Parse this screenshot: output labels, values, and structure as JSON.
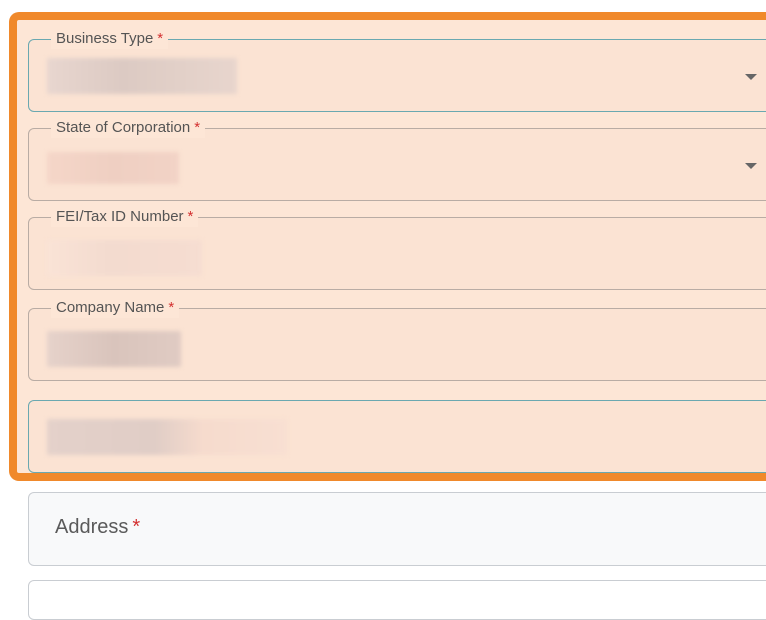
{
  "form": {
    "business_type": {
      "label": "Business Type",
      "required_mark": "*"
    },
    "state_of_corporation": {
      "label": "State of Corporation",
      "required_mark": "*"
    },
    "fei_tax_id": {
      "label": "FEI/Tax ID Number",
      "required_mark": "*"
    },
    "company_name": {
      "label": "Company Name",
      "required_mark": "*"
    },
    "address": {
      "placeholder": "Address",
      "required_mark": "*"
    }
  },
  "colors": {
    "highlight_border": "#f0892b",
    "highlight_fill": "#fde6d6",
    "required": "#d32f2f",
    "focus_border": "#6aa8b0"
  },
  "icons": {
    "dropdown": "chevron-down-icon"
  }
}
